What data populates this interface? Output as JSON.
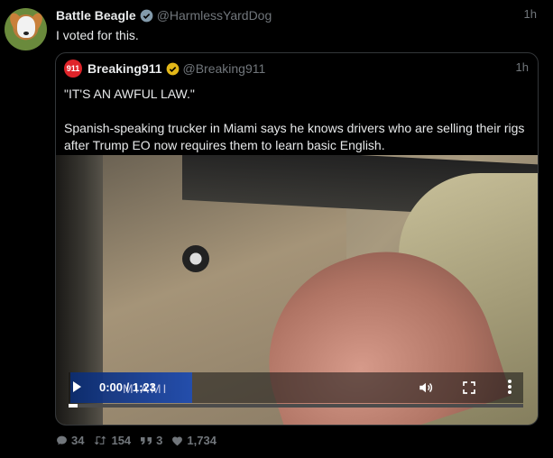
{
  "tweet": {
    "author_name": "Battle Beagle",
    "author_handle": "@HarmlessYardDog",
    "time": "1h",
    "text": "I voted for this."
  },
  "quote": {
    "logo_text": "911",
    "author_name": "Breaking911",
    "author_handle": "@Breaking911",
    "time": "1h",
    "paragraph1": "\"IT'S AN AWFUL LAW.\"",
    "paragraph2": "Spanish-speaking trucker in Miami says he knows drivers who are selling their rigs after Trump EO now requires them to learn basic English.",
    "video": {
      "time_display": "0:00 / 1:23",
      "station_logo": "MIAMI",
      "progress": 0.02
    }
  },
  "actions": {
    "replies": "34",
    "retweets": "154",
    "quotes": "3",
    "likes": "1,734"
  },
  "colors": {
    "background": "#000000",
    "text": "#e7e9ea",
    "muted": "#71767b",
    "verified_gray": "#829aab",
    "verified_gold": "#e2b719",
    "logo_red": "#e0242a"
  }
}
